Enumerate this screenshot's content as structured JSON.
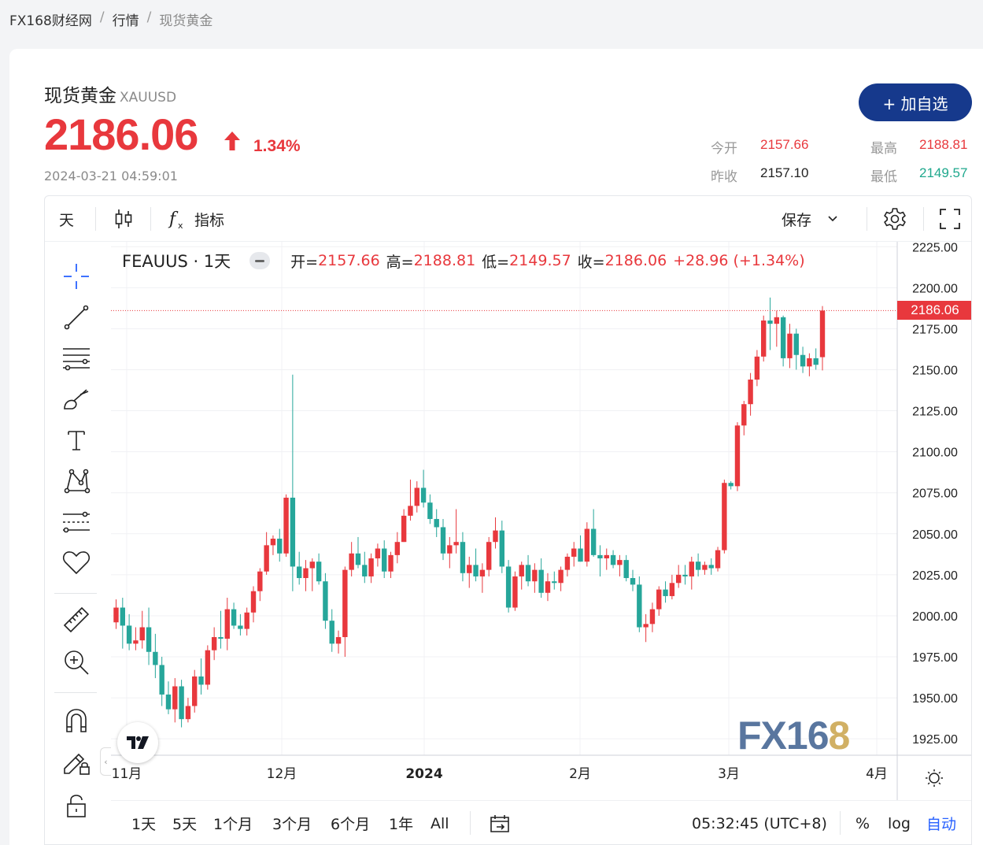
{
  "breadcrumb": {
    "home": "FX168财经网",
    "section": "行情",
    "current": "现货黄金",
    "separator": "/"
  },
  "header": {
    "name": "现货黄金",
    "code": "XAUUSD",
    "price": "2186.06",
    "change_pct": "1.34%",
    "timestamp": "2024-03-21 04:59:01",
    "add_button": "+ 加自选"
  },
  "stats": {
    "open_label": "今开",
    "open_value": "2157.66",
    "high_label": "最高",
    "high_value": "2188.81",
    "prev_close_label": "昨收",
    "prev_close_value": "2157.10",
    "low_label": "最低",
    "low_value": "2149.57"
  },
  "toolbar": {
    "interval": "天",
    "indicators_label": "指标",
    "save_label": "保存"
  },
  "legend": {
    "symbol": "FEAUUS · 1天",
    "open_key": "开=",
    "open_val": "2157.66",
    "high_key": "高=",
    "high_val": "2188.81",
    "low_key": "低=",
    "low_val": "2149.57",
    "close_key": "收=",
    "close_val": "2186.06",
    "change": "+28.96 (+1.34%)"
  },
  "bottom_bar": {
    "ranges": [
      "1天",
      "5天",
      "1个月",
      "3个月",
      "6个月",
      "1年",
      "All"
    ],
    "clock": "05:32:45 (UTC+8)",
    "percent": "%",
    "log": "log",
    "auto": "自动"
  },
  "watermark": {
    "a": "FX16",
    "b": "8"
  },
  "colors": {
    "up": "#e8383d",
    "down": "#26a69a",
    "accent": "#16398c",
    "auto_link": "#2962ff"
  },
  "chart_data": {
    "type": "candlestick",
    "ylim": [
      1915,
      2228
    ],
    "y_ticks": [
      "2225.00",
      "2200.00",
      "2175.00",
      "2150.00",
      "2125.00",
      "2100.00",
      "2075.00",
      "2050.00",
      "2025.00",
      "2000.00",
      "1975.00",
      "1950.00",
      "1925.00"
    ],
    "x_labels": [
      "11月",
      "12月",
      "2024",
      "2月",
      "3月",
      "4月"
    ],
    "last_price_label": "2186.06",
    "ohlc": [
      [
        1996,
        2010,
        1992,
        2005
      ],
      [
        2005,
        2011,
        1980,
        1994
      ],
      [
        1994,
        2001,
        1979,
        1983
      ],
      [
        1983,
        1993,
        1979,
        1985
      ],
      [
        1985,
        2003,
        1980,
        1993
      ],
      [
        1993,
        2005,
        1970,
        1978
      ],
      [
        1978,
        1989,
        1962,
        1970
      ],
      [
        1970,
        1975,
        1945,
        1952
      ],
      [
        1952,
        1960,
        1940,
        1943
      ],
      [
        1943,
        1962,
        1935,
        1957
      ],
      [
        1957,
        1961,
        1932,
        1937
      ],
      [
        1937,
        1950,
        1935,
        1945
      ],
      [
        1945,
        1967,
        1941,
        1963
      ],
      [
        1963,
        1974,
        1952,
        1958
      ],
      [
        1958,
        1982,
        1955,
        1979
      ],
      [
        1979,
        1993,
        1973,
        1987
      ],
      [
        1987,
        2003,
        1980,
        1986
      ],
      [
        1986,
        2011,
        1979,
        2004
      ],
      [
        2004,
        2008,
        1992,
        1994
      ],
      [
        1994,
        2001,
        1988,
        1992
      ],
      [
        1992,
        2005,
        1988,
        2002
      ],
      [
        2002,
        2018,
        1996,
        2015
      ],
      [
        2015,
        2029,
        2009,
        2027
      ],
      [
        2027,
        2051,
        2025,
        2043
      ],
      [
        2043,
        2049,
        2037,
        2047
      ],
      [
        2047,
        2053,
        2033,
        2038
      ],
      [
        2038,
        2074,
        2036,
        2072
      ],
      [
        2072,
        2147,
        2015,
        2030
      ],
      [
        2030,
        2039,
        2019,
        2023
      ],
      [
        2023,
        2034,
        2015,
        2029
      ],
      [
        2029,
        2035,
        2015,
        2033
      ],
      [
        2033,
        2038,
        2019,
        2021
      ],
      [
        2021,
        2026,
        1992,
        1997
      ],
      [
        1997,
        2004,
        1978,
        1983
      ],
      [
        1983,
        1991,
        1977,
        1987
      ],
      [
        1987,
        2030,
        1975,
        2028
      ],
      [
        2028,
        2045,
        2024,
        2038
      ],
      [
        2038,
        2048,
        2029,
        2031
      ],
      [
        2031,
        2039,
        2020,
        2024
      ],
      [
        2024,
        2038,
        2020,
        2035
      ],
      [
        2035,
        2044,
        2030,
        2041
      ],
      [
        2041,
        2046,
        2023,
        2027
      ],
      [
        2027,
        2039,
        2023,
        2037
      ],
      [
        2037,
        2051,
        2032,
        2045
      ],
      [
        2045,
        2065,
        2045,
        2061
      ],
      [
        2061,
        2083,
        2058,
        2067
      ],
      [
        2067,
        2082,
        2063,
        2078
      ],
      [
        2078,
        2089,
        2066,
        2069
      ],
      [
        2069,
        2074,
        2056,
        2059
      ],
      [
        2059,
        2065,
        2048,
        2054
      ],
      [
        2054,
        2059,
        2034,
        2038
      ],
      [
        2038,
        2048,
        2029,
        2043
      ],
      [
        2043,
        2065,
        2038,
        2045
      ],
      [
        2045,
        2051,
        2021,
        2026
      ],
      [
        2026,
        2036,
        2017,
        2031
      ],
      [
        2031,
        2041,
        2021,
        2024
      ],
      [
        2024,
        2032,
        2014,
        2028
      ],
      [
        2028,
        2048,
        2024,
        2045
      ],
      [
        2045,
        2060,
        2041,
        2052
      ],
      [
        2052,
        2058,
        2026,
        2030
      ],
      [
        2030,
        2034,
        2002,
        2005
      ],
      [
        2005,
        2027,
        2003,
        2024
      ],
      [
        2024,
        2033,
        2016,
        2031
      ],
      [
        2031,
        2037,
        2018,
        2021
      ],
      [
        2021,
        2032,
        2014,
        2028
      ],
      [
        2028,
        2035,
        2011,
        2014
      ],
      [
        2014,
        2026,
        2009,
        2021
      ],
      [
        2021,
        2027,
        2016,
        2020
      ],
      [
        2020,
        2030,
        2015,
        2028
      ],
      [
        2028,
        2038,
        2024,
        2036
      ],
      [
        2036,
        2045,
        2030,
        2041
      ],
      [
        2041,
        2049,
        2033,
        2033
      ],
      [
        2033,
        2057,
        2030,
        2053
      ],
      [
        2053,
        2065,
        2036,
        2037
      ],
      [
        2037,
        2043,
        2024,
        2035
      ],
      [
        2035,
        2041,
        2028,
        2037
      ],
      [
        2037,
        2040,
        2029,
        2031
      ],
      [
        2031,
        2037,
        2024,
        2034
      ],
      [
        2034,
        2037,
        2021,
        2023
      ],
      [
        2023,
        2028,
        2015,
        2019
      ],
      [
        2019,
        2024,
        1990,
        1993
      ],
      [
        1993,
        2001,
        1984,
        1995
      ],
      [
        1995,
        2008,
        1990,
        2004
      ],
      [
        2004,
        2018,
        2000,
        2016
      ],
      [
        2016,
        2021,
        2008,
        2012
      ],
      [
        2012,
        2025,
        2010,
        2020
      ],
      [
        2020,
        2031,
        2017,
        2025
      ],
      [
        2025,
        2031,
        2019,
        2024
      ],
      [
        2024,
        2036,
        2016,
        2033
      ],
      [
        2033,
        2038,
        2024,
        2028
      ],
      [
        2028,
        2033,
        2025,
        2031
      ],
      [
        2031,
        2035,
        2025,
        2029
      ],
      [
        2029,
        2042,
        2027,
        2040
      ],
      [
        2040,
        2083,
        2038,
        2081
      ],
      [
        2081,
        2082,
        2077,
        2079
      ],
      [
        2079,
        2118,
        2076,
        2116
      ],
      [
        2116,
        2131,
        2110,
        2129
      ],
      [
        2129,
        2148,
        2122,
        2144
      ],
      [
        2144,
        2162,
        2140,
        2158
      ],
      [
        2158,
        2183,
        2155,
        2180
      ],
      [
        2180,
        2194,
        2162,
        2178
      ],
      [
        2178,
        2186,
        2164,
        2182
      ],
      [
        2182,
        2183,
        2152,
        2157
      ],
      [
        2157,
        2178,
        2151,
        2172
      ],
      [
        2172,
        2175,
        2150,
        2159
      ],
      [
        2159,
        2164,
        2148,
        2152
      ],
      [
        2152,
        2160,
        2146,
        2157
      ],
      [
        2157,
        2163,
        2150,
        2153
      ],
      [
        2157.66,
        2188.81,
        2149.57,
        2186.06
      ]
    ]
  }
}
